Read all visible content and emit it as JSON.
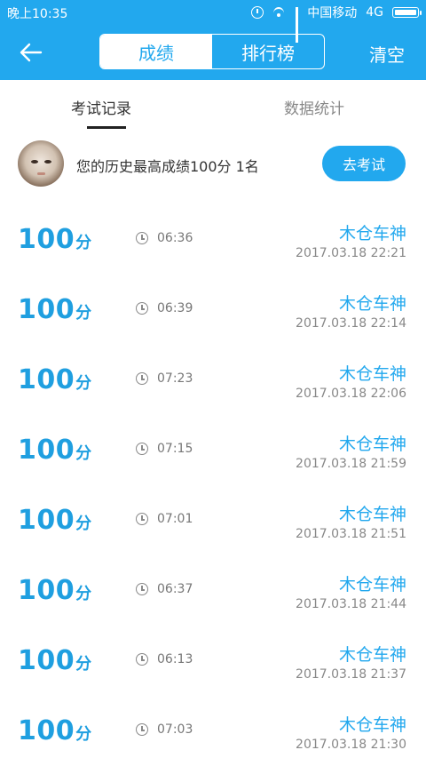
{
  "status_bar": {
    "time": "晚上10:35",
    "carrier": "中国移动",
    "network": "4G"
  },
  "header": {
    "back_icon": "arrow-left-icon",
    "tabs": [
      {
        "label": "成绩",
        "active": true
      },
      {
        "label": "排行榜",
        "active": false
      }
    ],
    "clear_label": "清空"
  },
  "subtabs": [
    {
      "label": "考试记录",
      "active": true
    },
    {
      "label": "数据统计",
      "active": false
    }
  ],
  "profile": {
    "best_text": "您的历史最高成绩100分  1名",
    "go_exam_label": "去考试"
  },
  "records": [
    {
      "score": "100",
      "unit": "分",
      "duration": "06:36",
      "user": "木仓车神",
      "date": "2017.03.18  22:21"
    },
    {
      "score": "100",
      "unit": "分",
      "duration": "06:39",
      "user": "木仓车神",
      "date": "2017.03.18  22:14"
    },
    {
      "score": "100",
      "unit": "分",
      "duration": "07:23",
      "user": "木仓车神",
      "date": "2017.03.18  22:06"
    },
    {
      "score": "100",
      "unit": "分",
      "duration": "07:15",
      "user": "木仓车神",
      "date": "2017.03.18  21:59"
    },
    {
      "score": "100",
      "unit": "分",
      "duration": "07:01",
      "user": "木仓车神",
      "date": "2017.03.18  21:51"
    },
    {
      "score": "100",
      "unit": "分",
      "duration": "06:37",
      "user": "木仓车神",
      "date": "2017.03.18  21:44"
    },
    {
      "score": "100",
      "unit": "分",
      "duration": "06:13",
      "user": "木仓车神",
      "date": "2017.03.18  21:37"
    },
    {
      "score": "100",
      "unit": "分",
      "duration": "07:03",
      "user": "木仓车神",
      "date": "2017.03.18  21:30"
    }
  ],
  "colors": {
    "primary": "#22a8ee",
    "score": "#1f9fe0"
  }
}
